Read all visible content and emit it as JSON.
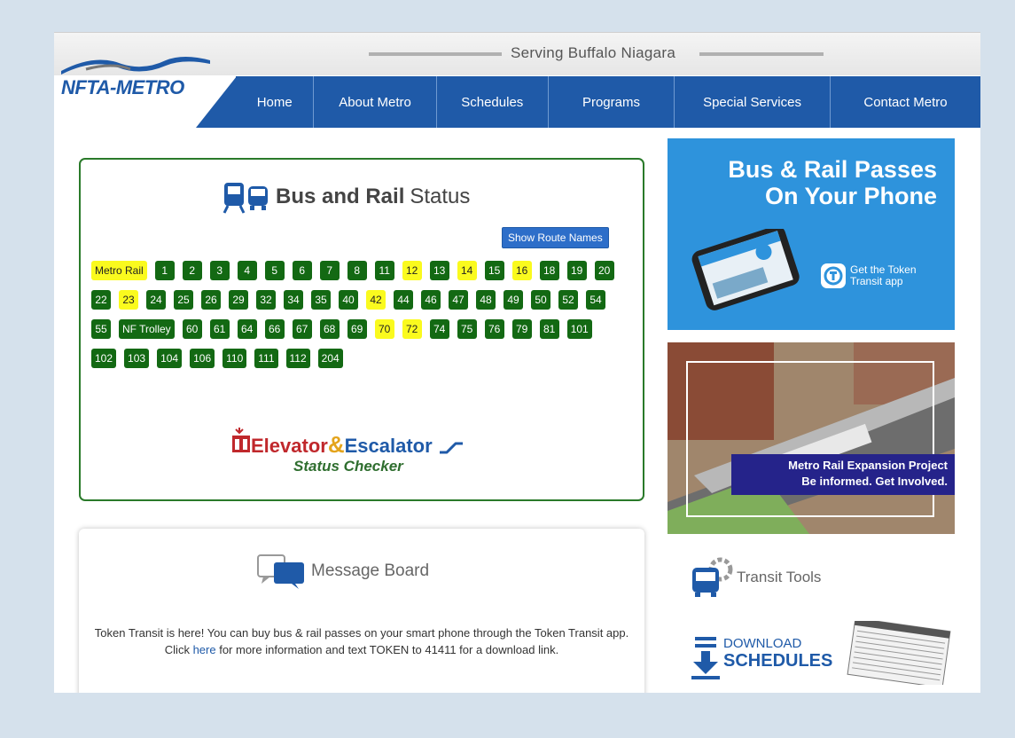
{
  "header": {
    "tagline": "Serving Buffalo Niagara",
    "logo_text": "NFTA-METRO",
    "nav": [
      "Home",
      "About Metro",
      "Schedules",
      "Programs",
      "Special Services",
      "Contact Metro"
    ]
  },
  "status": {
    "title_bold": "Bus and Rail",
    "title_rest": "Status",
    "show_routes_label": "Show Route Names",
    "routes": [
      {
        "label": "Metro Rail",
        "alert": true
      },
      {
        "label": "1",
        "alert": false
      },
      {
        "label": "2",
        "alert": false
      },
      {
        "label": "3",
        "alert": false
      },
      {
        "label": "4",
        "alert": false
      },
      {
        "label": "5",
        "alert": false
      },
      {
        "label": "6",
        "alert": false
      },
      {
        "label": "7",
        "alert": false
      },
      {
        "label": "8",
        "alert": false
      },
      {
        "label": "11",
        "alert": false
      },
      {
        "label": "12",
        "alert": true
      },
      {
        "label": "13",
        "alert": false
      },
      {
        "label": "14",
        "alert": true
      },
      {
        "label": "15",
        "alert": false
      },
      {
        "label": "16",
        "alert": true
      },
      {
        "label": "18",
        "alert": false
      },
      {
        "label": "19",
        "alert": false
      },
      {
        "label": "20",
        "alert": false
      },
      {
        "label": "22",
        "alert": false
      },
      {
        "label": "23",
        "alert": true
      },
      {
        "label": "24",
        "alert": false
      },
      {
        "label": "25",
        "alert": false
      },
      {
        "label": "26",
        "alert": false
      },
      {
        "label": "29",
        "alert": false
      },
      {
        "label": "32",
        "alert": false
      },
      {
        "label": "34",
        "alert": false
      },
      {
        "label": "35",
        "alert": false
      },
      {
        "label": "40",
        "alert": false
      },
      {
        "label": "42",
        "alert": true
      },
      {
        "label": "44",
        "alert": false
      },
      {
        "label": "46",
        "alert": false
      },
      {
        "label": "47",
        "alert": false
      },
      {
        "label": "48",
        "alert": false
      },
      {
        "label": "49",
        "alert": false
      },
      {
        "label": "50",
        "alert": false
      },
      {
        "label": "52",
        "alert": false
      },
      {
        "label": "54",
        "alert": false
      },
      {
        "label": "55",
        "alert": false
      },
      {
        "label": "NF Trolley",
        "alert": false
      },
      {
        "label": "60",
        "alert": false
      },
      {
        "label": "61",
        "alert": false
      },
      {
        "label": "64",
        "alert": false
      },
      {
        "label": "66",
        "alert": false
      },
      {
        "label": "67",
        "alert": false
      },
      {
        "label": "68",
        "alert": false
      },
      {
        "label": "69",
        "alert": false
      },
      {
        "label": "70",
        "alert": true
      },
      {
        "label": "72",
        "alert": true
      },
      {
        "label": "74",
        "alert": false
      },
      {
        "label": "75",
        "alert": false
      },
      {
        "label": "76",
        "alert": false
      },
      {
        "label": "79",
        "alert": false
      },
      {
        "label": "81",
        "alert": false
      },
      {
        "label": "101",
        "alert": false
      },
      {
        "label": "102",
        "alert": false
      },
      {
        "label": "103",
        "alert": false
      },
      {
        "label": "104",
        "alert": false
      },
      {
        "label": "106",
        "alert": false
      },
      {
        "label": "110",
        "alert": false
      },
      {
        "label": "111",
        "alert": false
      },
      {
        "label": "112",
        "alert": false
      },
      {
        "label": "204",
        "alert": false
      }
    ],
    "elevator_word": "Elevator",
    "amp": "&",
    "escalator_word": "Escalator",
    "checker": "Status Checker"
  },
  "message_board": {
    "title": "Message Board",
    "text_before": "Token Transit is here! You can buy bus & rail passes on your smart phone through the Token Transit app. Click ",
    "link_text": "here",
    "text_after": " for more information and text TOKEN to 41411 for a download link."
  },
  "sidebar": {
    "phone_ad_line1": "Bus & Rail Passes",
    "phone_ad_line2": "On Your Phone",
    "phone_ad_cta": "Get the Token Transit app",
    "rail_ad_line1": "Metro Rail Expansion Project",
    "rail_ad_line2": "Be informed. Get Involved.",
    "transit_tools": "Transit Tools",
    "download_line1": "DOWNLOAD",
    "download_line2": "SCHEDULES"
  },
  "colors": {
    "nav_blue": "#1f5aa8",
    "route_green": "#136913",
    "alert_yellow": "#fafa1e",
    "phone_ad_blue": "#2e93dc"
  }
}
